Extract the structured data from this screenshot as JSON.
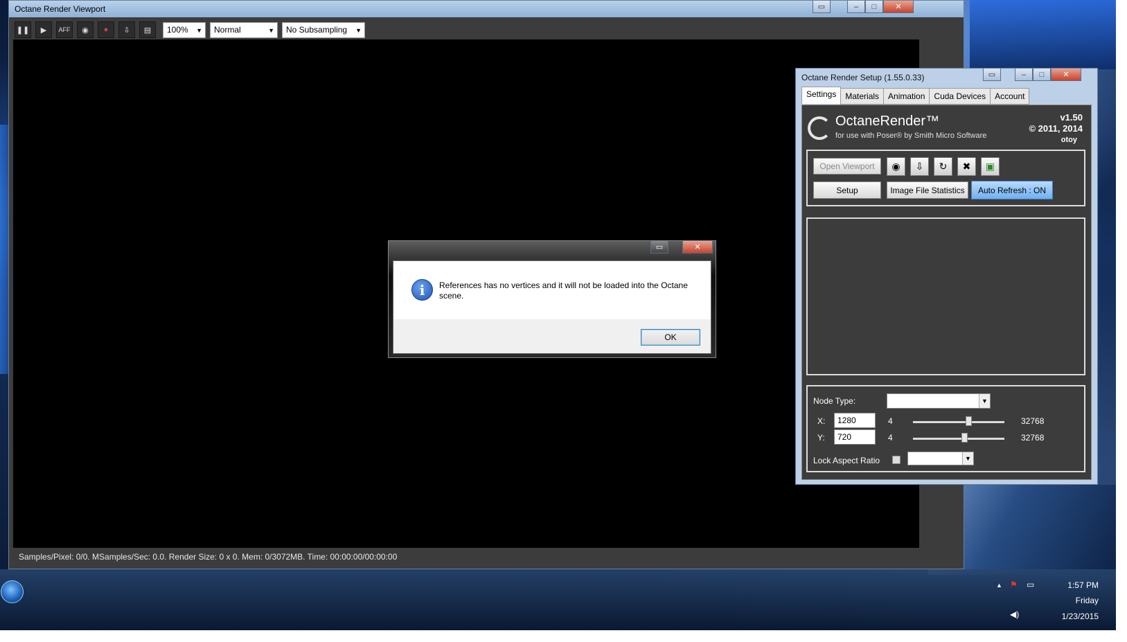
{
  "viewport": {
    "title": "Octane Render Viewport",
    "zoom": "100%",
    "mode": "Normal",
    "subsampling": "No Subsampling",
    "status": "Samples/Pixel: 0/0. MSamples/Sec: 0.0. Render Size: 0 x 0. Mem: 0/3072MB. Time: 00:00:00/00:00:00",
    "toolbar_icons": [
      "pause-icon",
      "play-icon",
      "aff-icon",
      "camera-icon",
      "color-wheel-icon",
      "export-icon",
      "document-icon"
    ]
  },
  "setup": {
    "title": "Octane Render Setup (1.55.0.33)",
    "tabs": [
      "Settings",
      "Materials",
      "Animation",
      "Cuda Devices",
      "Account"
    ],
    "brand": "OctaneRender™",
    "brand_sub": "for use with Poser® by Smith Micro Software",
    "version": "v1.50",
    "copyright": "© 2011, 2014",
    "otoy": "otoy",
    "open_viewport": "Open Viewport",
    "setup_btn": "Setup",
    "image_stats": "Image File Statistics",
    "auto_refresh": "Auto Refresh : ON",
    "node_type_label": "Node Type:",
    "x_label": "X:",
    "y_label": "Y:",
    "x_value": "1280",
    "y_value": "720",
    "x_min": "4",
    "x_max": "32768",
    "y_min": "4",
    "y_max": "32768",
    "lock_label": "Lock Aspect Ratio"
  },
  "dialog": {
    "message": "References has no vertices and it will not be loaded into the Octane scene.",
    "ok": "OK"
  },
  "taskbar": {
    "time": "1:57 PM",
    "day": "Friday",
    "date": "1/23/2015"
  }
}
